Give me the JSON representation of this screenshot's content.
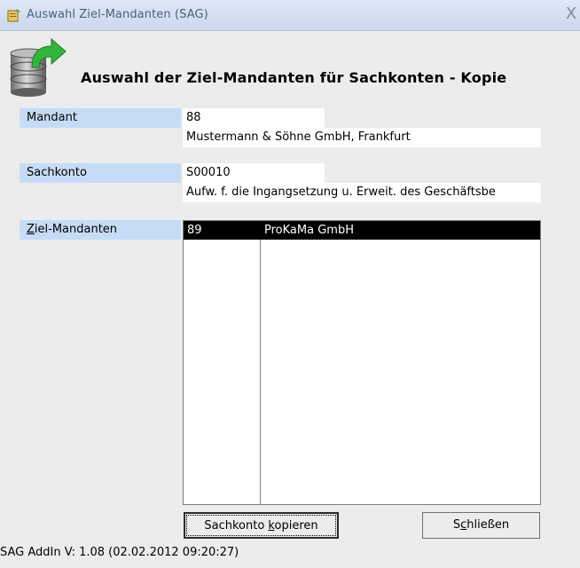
{
  "window": {
    "title": "Auswahl Ziel-Mandanten (SAG)",
    "close_label": "X"
  },
  "header": {
    "heading": "Auswahl der Ziel-Mandanten für Sachkonten - Kopie"
  },
  "mandant": {
    "label": "Mandant",
    "number": "88",
    "name": "Mustermann & Söhne GmbH, Frankfurt"
  },
  "sachkonto": {
    "label": "Sachkonto",
    "number": "S00010",
    "description": "Aufw. f. die Ingangsetzung u. Erweit. des Geschäftsbe"
  },
  "ziel_mandanten": {
    "label_prefix": "",
    "label_accel": "Z",
    "label_rest": "iel-Mandanten",
    "items": [
      {
        "number": "89",
        "name": "ProKaMa GmbH"
      }
    ]
  },
  "buttons": {
    "copy_pre": "Sachkonto ",
    "copy_accel": "k",
    "copy_post": "opieren",
    "close_pre": "S",
    "close_accel": "c",
    "close_post": "hließen"
  },
  "status": {
    "version": "SAG AddIn V:  1.08 (02.02.2012 09:20:27)"
  },
  "colors": {
    "label_bg": "#c6dcf6",
    "selection_bg": "#000000",
    "window_bg": "#ececec"
  }
}
